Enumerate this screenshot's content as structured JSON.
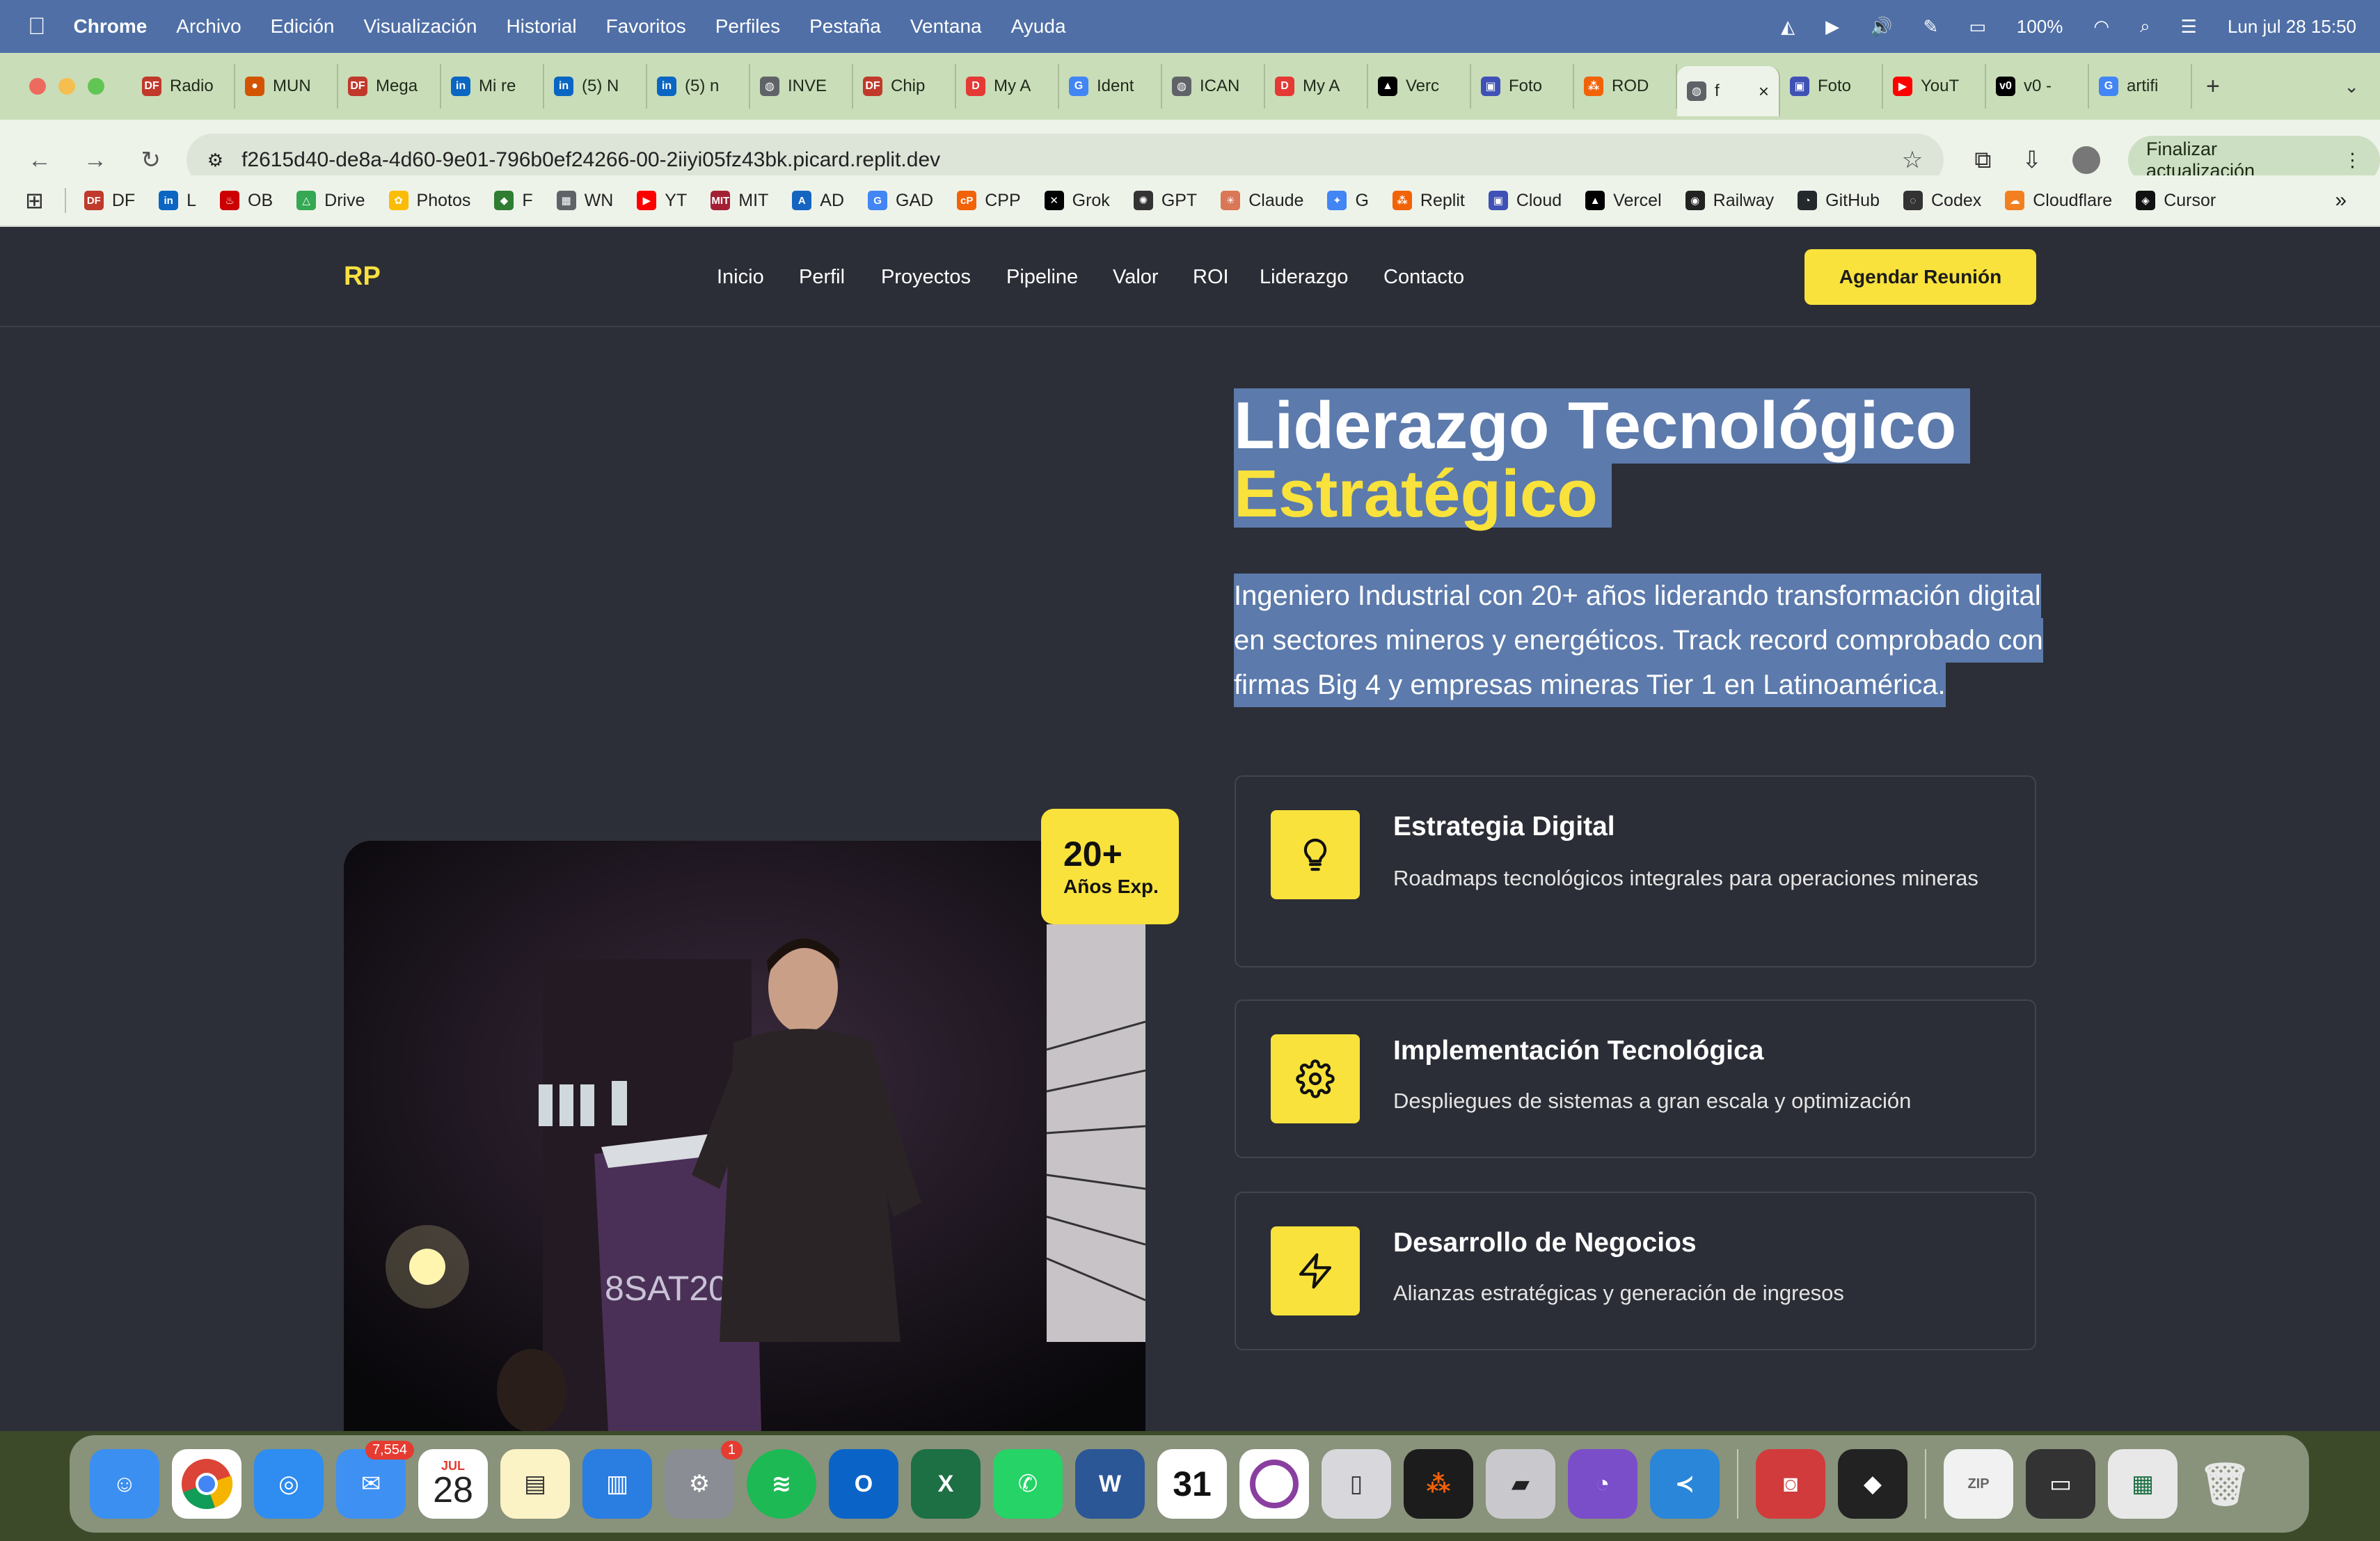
{
  "menubar": {
    "app": "Chrome",
    "items": [
      "Archivo",
      "Edición",
      "Visualización",
      "Historial",
      "Favoritos",
      "Perfiles",
      "Pestaña",
      "Ventana",
      "Ayuda"
    ],
    "battery": "100%",
    "datetime": "Lun jul 28  15:50"
  },
  "tabs": [
    {
      "label": "Radio",
      "color": "#c0392b",
      "glyph": "DF"
    },
    {
      "label": "MUN",
      "color": "#d35400",
      "glyph": "●"
    },
    {
      "label": "Mega",
      "color": "#c0392b",
      "glyph": "DF"
    },
    {
      "label": "Mi re",
      "color": "#0a66c2",
      "glyph": "in"
    },
    {
      "label": "(5) N",
      "color": "#0a66c2",
      "glyph": "in"
    },
    {
      "label": "(5) n",
      "color": "#0a66c2",
      "glyph": "in"
    },
    {
      "label": "INVE",
      "color": "#5f6368",
      "glyph": "◍"
    },
    {
      "label": "Chip",
      "color": "#c0392b",
      "glyph": "DF"
    },
    {
      "label": "My A",
      "color": "#e53935",
      "glyph": "D"
    },
    {
      "label": "Ident",
      "color": "#4285f4",
      "glyph": "G"
    },
    {
      "label": "ICAN",
      "color": "#5f6368",
      "glyph": "◍"
    },
    {
      "label": "My A",
      "color": "#e53935",
      "glyph": "D"
    },
    {
      "label": "Verc",
      "color": "#000000",
      "glyph": "▲"
    },
    {
      "label": "Foto",
      "color": "#3f51b5",
      "glyph": "▣"
    },
    {
      "label": "ROD",
      "color": "#f26207",
      "glyph": "⁂"
    },
    {
      "label": "f",
      "color": "#5f6368",
      "glyph": "◍",
      "active": true
    },
    {
      "label": "Foto",
      "color": "#3f51b5",
      "glyph": "▣"
    },
    {
      "label": "YouT",
      "color": "#ff0000",
      "glyph": "▶"
    },
    {
      "label": "v0 -",
      "color": "#000000",
      "glyph": "v0"
    },
    {
      "label": "artifi",
      "color": "#4285f4",
      "glyph": "G"
    }
  ],
  "address": {
    "url": "f2615d40-de8a-4d60-9e01-796b0ef24266-00-2iiyi05fz43bk.picard.replit.dev",
    "update_label": "Finalizar actualización"
  },
  "bookmarks": [
    {
      "label": "DF",
      "color": "#c0392b",
      "glyph": "DF"
    },
    {
      "label": "L",
      "color": "#0a66c2",
      "glyph": "in"
    },
    {
      "label": "OB",
      "color": "#cc0000",
      "glyph": "♨"
    },
    {
      "label": "Drive",
      "color": "#34a853",
      "glyph": "△"
    },
    {
      "label": "Photos",
      "color": "#fbbc05",
      "glyph": "✿"
    },
    {
      "label": "F",
      "color": "#2e7d32",
      "glyph": "◆"
    },
    {
      "label": "WN",
      "color": "#5f6368",
      "glyph": "▦"
    },
    {
      "label": "YT",
      "color": "#ff0000",
      "glyph": "▶"
    },
    {
      "label": "MIT",
      "color": "#a31f34",
      "glyph": "MIT"
    },
    {
      "label": "AD",
      "color": "#1565c0",
      "glyph": "A"
    },
    {
      "label": "GAD",
      "color": "#4285f4",
      "glyph": "G"
    },
    {
      "label": "CPP",
      "color": "#f26207",
      "glyph": "cP"
    },
    {
      "label": "Grok",
      "color": "#000000",
      "glyph": "✕"
    },
    {
      "label": "GPT",
      "color": "#333333",
      "glyph": "✺"
    },
    {
      "label": "Claude",
      "color": "#d97757",
      "glyph": "✳"
    },
    {
      "label": "G",
      "color": "#4285f4",
      "glyph": "✦"
    },
    {
      "label": "Replit",
      "color": "#f26207",
      "glyph": "⁂"
    },
    {
      "label": "Cloud",
      "color": "#3f51b5",
      "glyph": "▣"
    },
    {
      "label": "Vercel",
      "color": "#000000",
      "glyph": "▲"
    },
    {
      "label": "Railway",
      "color": "#222222",
      "glyph": "◉"
    },
    {
      "label": "GitHub",
      "color": "#24292e",
      "glyph": "◔"
    },
    {
      "label": "Codex",
      "color": "#333333",
      "glyph": "◌"
    },
    {
      "label": "Cloudflare",
      "color": "#f38020",
      "glyph": "☁"
    },
    {
      "label": "Cursor",
      "color": "#111111",
      "glyph": "◈"
    }
  ],
  "site": {
    "logo": "RP",
    "nav": [
      "Inicio",
      "Perfil",
      "Proyectos",
      "Pipeline",
      "Valor",
      "ROI",
      "Liderazgo",
      "Contacto"
    ],
    "cta": "Agendar Reunión",
    "hero_title_line1": "Liderazgo Tecnológico",
    "hero_title_line2": "Estratégico",
    "hero_text_lines": [
      "Ingeniero Industrial con 20+ años liderando transformación digital",
      "en sectores mineros y energéticos. Track record comprobado con",
      "firmas Big 4 y empresas mineras Tier 1 en Latinoamérica."
    ],
    "badge_number": "20+",
    "badge_label": "Años Exp.",
    "podium_text": "8SAT2022",
    "cards": [
      {
        "title": "Estrategia Digital",
        "desc": "Roadmaps tecnológicos integrales para operaciones mineras",
        "icon": "lightbulb-icon"
      },
      {
        "title": "Implementación Tecnológica",
        "desc": "Despliegues de sistemas a gran escala y optimización",
        "icon": "gear-icon"
      },
      {
        "title": "Desarrollo de Negocios",
        "desc": "Alianzas estratégicas y generación de ingresos",
        "icon": "lightning-icon"
      }
    ],
    "colors": {
      "accent": "#f9e23b",
      "background": "#2c2f37",
      "selection": "#5c7aab"
    }
  },
  "dock": {
    "mail_badge": "7,554",
    "calendar_month": "JUL",
    "calendar_day": "28",
    "settings_badge": "1",
    "calendar2_day": "31",
    "apps": [
      "Finder",
      "Chrome",
      "Safari",
      "Mail",
      "Calendar",
      "Notes",
      "Keynote",
      "System Settings",
      "Spotify",
      "Outlook",
      "Excel",
      "WhatsApp",
      "Word",
      "Calendar",
      "Screen Recorder",
      "iPhone Mirroring",
      "Replit",
      "Parallels",
      "GitHub Desktop",
      "VS Code",
      "Photo Booth",
      "Unity",
      "Archive",
      "Screenshot",
      "Spreadsheet",
      "Trash"
    ]
  }
}
